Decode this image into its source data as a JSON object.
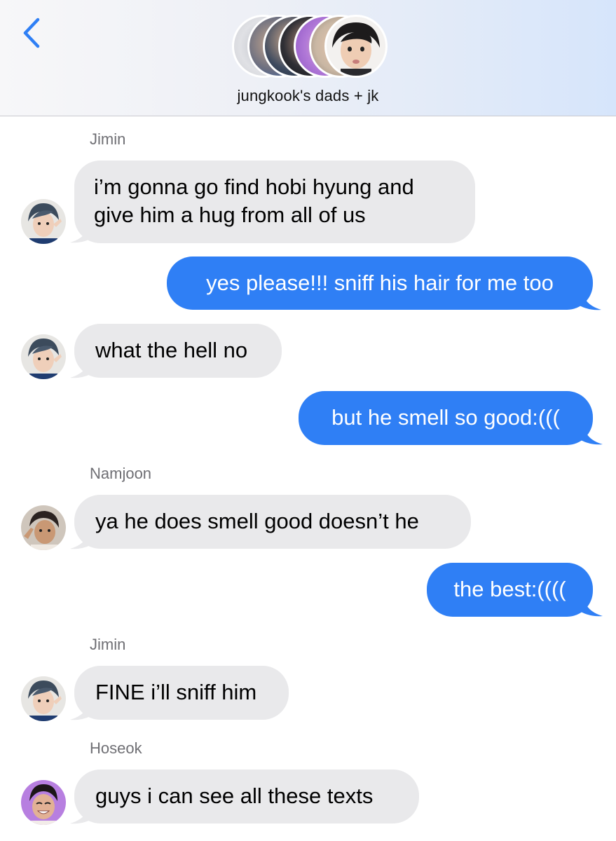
{
  "header": {
    "back_icon": "chevron-left-icon",
    "group_name": "jungkook's dads + jk",
    "accent": "#2f7ff5"
  },
  "colors": {
    "incoming_bubble": "#e9e9eb",
    "outgoing_bubble": "#2f7ff5"
  },
  "messages": [
    {
      "direction": "incoming",
      "sender": "Jimin",
      "lines": [
        "i’m gonna go find hobi hyung and",
        "give him a hug from all of us"
      ]
    },
    {
      "direction": "outgoing",
      "text": "yes please!!! sniff his hair for me too"
    },
    {
      "direction": "incoming",
      "text": "what the hell no"
    },
    {
      "direction": "outgoing",
      "text": "but he smell so good:((("
    },
    {
      "direction": "incoming",
      "sender": "Namjoon",
      "text": "ya he does smell good doesn’t he"
    },
    {
      "direction": "outgoing",
      "text": "the best:(((("
    },
    {
      "direction": "incoming",
      "sender": "Jimin",
      "text": "FINE i’ll sniff him"
    },
    {
      "direction": "incoming",
      "sender": "Hoseok",
      "text": "guys i can see all these texts"
    }
  ]
}
